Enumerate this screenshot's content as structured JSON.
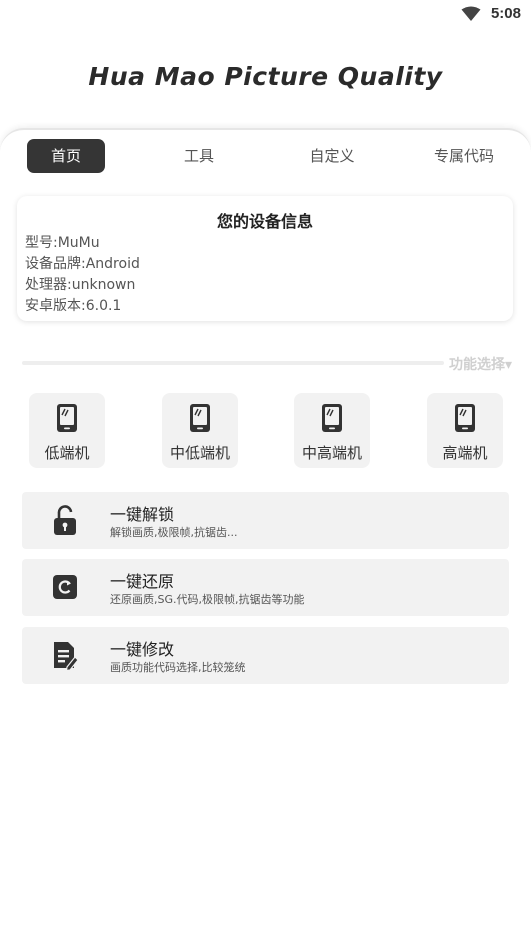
{
  "status_bar": {
    "time": "5:08",
    "wifi_icon": "wifi-icon"
  },
  "app": {
    "title": "Hua Mao Picture Quality"
  },
  "tabs": [
    {
      "label": "首页",
      "active": true
    },
    {
      "label": "工具",
      "active": false
    },
    {
      "label": "自定义",
      "active": false
    },
    {
      "label": "专属代码",
      "active": false
    }
  ],
  "device_info": {
    "title": "您的设备信息",
    "lines": [
      "型号:MuMu",
      "设备品牌:Android",
      "处理器:unknown",
      "安卓版本:6.0.1"
    ]
  },
  "section": {
    "label": "功能选择▾"
  },
  "levels": [
    {
      "label": "低端机",
      "icon": "phone-icon"
    },
    {
      "label": "中低端机",
      "icon": "phone-icon"
    },
    {
      "label": "中高端机",
      "icon": "phone-icon"
    },
    {
      "label": "高端机",
      "icon": "phone-icon"
    }
  ],
  "actions": [
    {
      "title": "一键解锁",
      "desc": "解锁画质,极限帧,抗锯齿...",
      "icon": "unlock-icon"
    },
    {
      "title": "一键还原",
      "desc": "还原画质,SG.代码,极限帧,抗锯齿等功能",
      "icon": "restore-icon"
    },
    {
      "title": "一键修改",
      "desc": "画质功能代码选择,比较笼统",
      "icon": "edit-document-icon"
    }
  ],
  "colors": {
    "accent": "#353535",
    "card_bg": "#f2f2f2",
    "muted_label": "#d0d0d0"
  }
}
